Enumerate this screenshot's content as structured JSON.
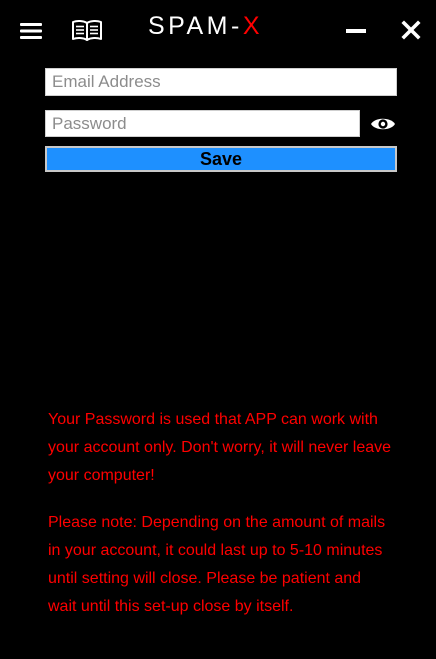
{
  "titlebar": {
    "title_main": "SPAM-",
    "title_accent": "X",
    "accent_color": "#ff0000",
    "menu_icon": "hamburger-menu-icon",
    "book_icon": "book-icon",
    "minimize_icon": "minimize-icon",
    "close_icon": "close-icon"
  },
  "form": {
    "email_placeholder": "Email Address",
    "email_value": "",
    "password_placeholder": "Password",
    "password_value": "",
    "show_password_icon": "eye-icon",
    "save_label": "Save",
    "save_color": "#1e90ff"
  },
  "info": {
    "password_text": "Your Password is used that APP can work with your account only. Don't worry, it will never leave your computer!",
    "note_text": "Please note: Depending on the amount of mails in your account, it could last up to 5-10 minutes until setting will close. Please be patient and wait until this set-up close by itself."
  }
}
